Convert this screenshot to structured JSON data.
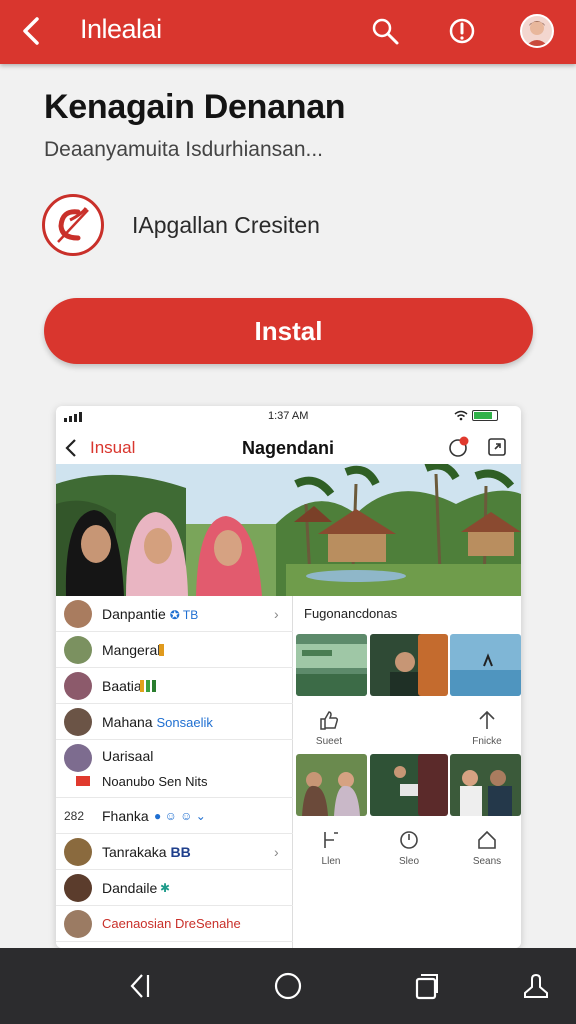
{
  "appbar": {
    "title": "Inlealai",
    "icons": [
      "back-arrow-icon",
      "search-icon",
      "info-icon",
      "profile-avatar"
    ],
    "color": "#d9362e"
  },
  "app": {
    "title": "Kenagain Denanan",
    "subtitle": "Deaanyamuita Isdurhiansan...",
    "developer": "IApgallan Cresiten",
    "install_label": "Instal"
  },
  "screenshot": {
    "status_time": "1:37 AM",
    "back_label": "Insual",
    "title": "Nagendani",
    "contacts": [
      {
        "name": "Danpantie",
        "badge": "✪ TB"
      },
      {
        "name": "Mangeral",
        "badge": ""
      },
      {
        "name": "Baatia",
        "badge": ""
      },
      {
        "name": "Mahana",
        "badge": "Sonsaelik"
      },
      {
        "name": "Uarisaal",
        "badge": ""
      },
      {
        "name": "Noanubo Sen Nits",
        "badge": ""
      },
      {
        "name": "Fhanka",
        "badge": ""
      },
      {
        "name": "Tanrakaka",
        "badge": "BB"
      },
      {
        "name": "Dandaile",
        "badge": ""
      },
      {
        "name": "Caenaosian DreSenahe",
        "badge": ""
      }
    ],
    "row_prefix": "282",
    "grid_title": "Fugonancdonas",
    "actions_top": [
      "Sueet",
      "Fnicke"
    ],
    "actions_bottom": [
      "Llen",
      "Sleo",
      "Seans"
    ]
  },
  "navbar": {
    "icons": [
      "back-icon",
      "home-icon",
      "recents-icon",
      "person-icon"
    ]
  }
}
